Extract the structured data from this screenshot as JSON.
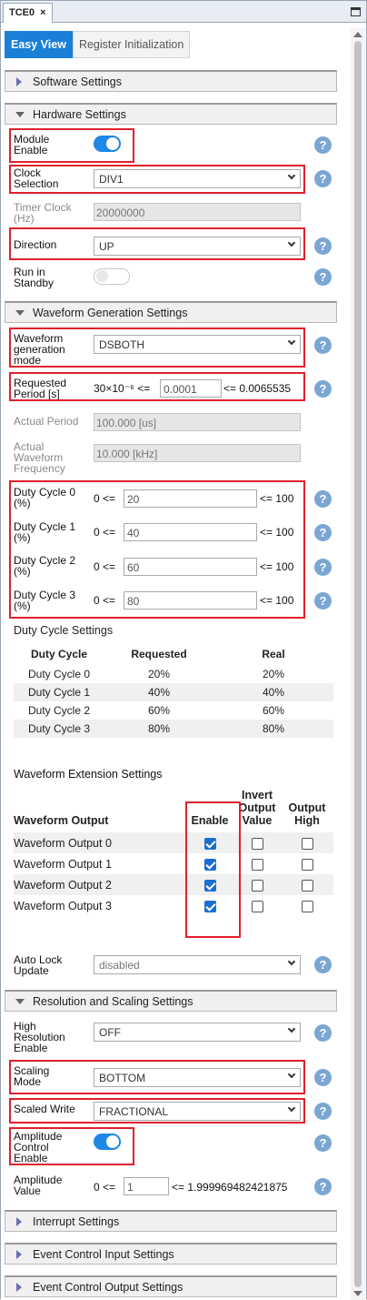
{
  "window": {
    "tab_title": "TCE0",
    "close_glyph": "×"
  },
  "view_tabs": [
    "Easy View",
    "Register Initialization"
  ],
  "sections": {
    "software": "Software Settings",
    "hardware": "Hardware Settings",
    "waveform": "Waveform Generation Settings",
    "resolution": "Resolution and Scaling Settings",
    "interrupt": "Interrupt Settings",
    "event_in": "Event Control Input Settings",
    "event_out": "Event Control Output Settings"
  },
  "hardware": {
    "module_enable": {
      "label": "Module Enable",
      "value": true
    },
    "clock_selection": {
      "label": "Clock Selection",
      "value": "DIV1"
    },
    "timer_clock": {
      "label": "Timer Clock (Hz)",
      "value": "20000000"
    },
    "direction": {
      "label": "Direction",
      "value": "UP"
    },
    "run_in_standby": {
      "label": "Run in Standby",
      "value": false
    }
  },
  "waveform": {
    "mode": {
      "label": "Waveform generation mode",
      "value": "DSBOTH"
    },
    "period": {
      "label": "Requested Period [s]",
      "min": "30×10⁻⁶ <=",
      "value": "0.0001",
      "max": "<= 0.0065535"
    },
    "actual_period": {
      "label": "Actual Period",
      "value": "100.000 [us]"
    },
    "actual_freq": {
      "label": "Actual Waveform Frequency",
      "value": "10.000 [kHz]"
    },
    "duty": [
      {
        "label": "Duty Cycle 0 (%)",
        "min": "0 <=",
        "value": "20",
        "max": "<= 100"
      },
      {
        "label": "Duty Cycle 1 (%)",
        "min": "0 <=",
        "value": "40",
        "max": "<= 100"
      },
      {
        "label": "Duty Cycle 2 (%)",
        "min": "0 <=",
        "value": "60",
        "max": "<= 100"
      },
      {
        "label": "Duty Cycle 3 (%)",
        "min": "0 <=",
        "value": "80",
        "max": "<= 100"
      }
    ],
    "duty_settings_title": "Duty Cycle Settings",
    "duty_table": {
      "headers": [
        "Duty Cycle",
        "Requested",
        "Real"
      ],
      "rows": [
        [
          "Duty Cycle 0",
          "20%",
          "20%"
        ],
        [
          "Duty Cycle 1",
          "40%",
          "40%"
        ],
        [
          "Duty Cycle 2",
          "60%",
          "60%"
        ],
        [
          "Duty Cycle 3",
          "80%",
          "80%"
        ]
      ]
    },
    "ext_title": "Waveform Extension Settings",
    "ext_table": {
      "headers": [
        "Waveform Output",
        "Enable",
        "Invert Output Value",
        "Output High"
      ],
      "rows": [
        {
          "name": "Waveform Output 0",
          "enable": true,
          "invert": false,
          "high": false
        },
        {
          "name": "Waveform Output 1",
          "enable": true,
          "invert": false,
          "high": false
        },
        {
          "name": "Waveform Output 2",
          "enable": true,
          "invert": false,
          "high": false
        },
        {
          "name": "Waveform Output 3",
          "enable": true,
          "invert": false,
          "high": false
        }
      ]
    },
    "auto_lock": {
      "label": "Auto Lock Update",
      "value": "disabled"
    }
  },
  "resolution": {
    "high_res": {
      "label": "High Resolution Enable",
      "value": "OFF"
    },
    "scaling_mode": {
      "label": "Scaling Mode",
      "value": "BOTTOM"
    },
    "scaled_write": {
      "label": "Scaled Write",
      "value": "FRACTIONAL"
    },
    "amp_enable": {
      "label": "Amplitude Control Enable",
      "value": true
    },
    "amp_value": {
      "label": "Amplitude Value",
      "min": "0 <=",
      "value": "1",
      "max": "<= 1.999969482421875"
    }
  },
  "help_glyph": "?",
  "colors": {
    "accent": "#1a7fd6",
    "highlight": "#e0202c",
    "help": "#7ba6d4"
  }
}
